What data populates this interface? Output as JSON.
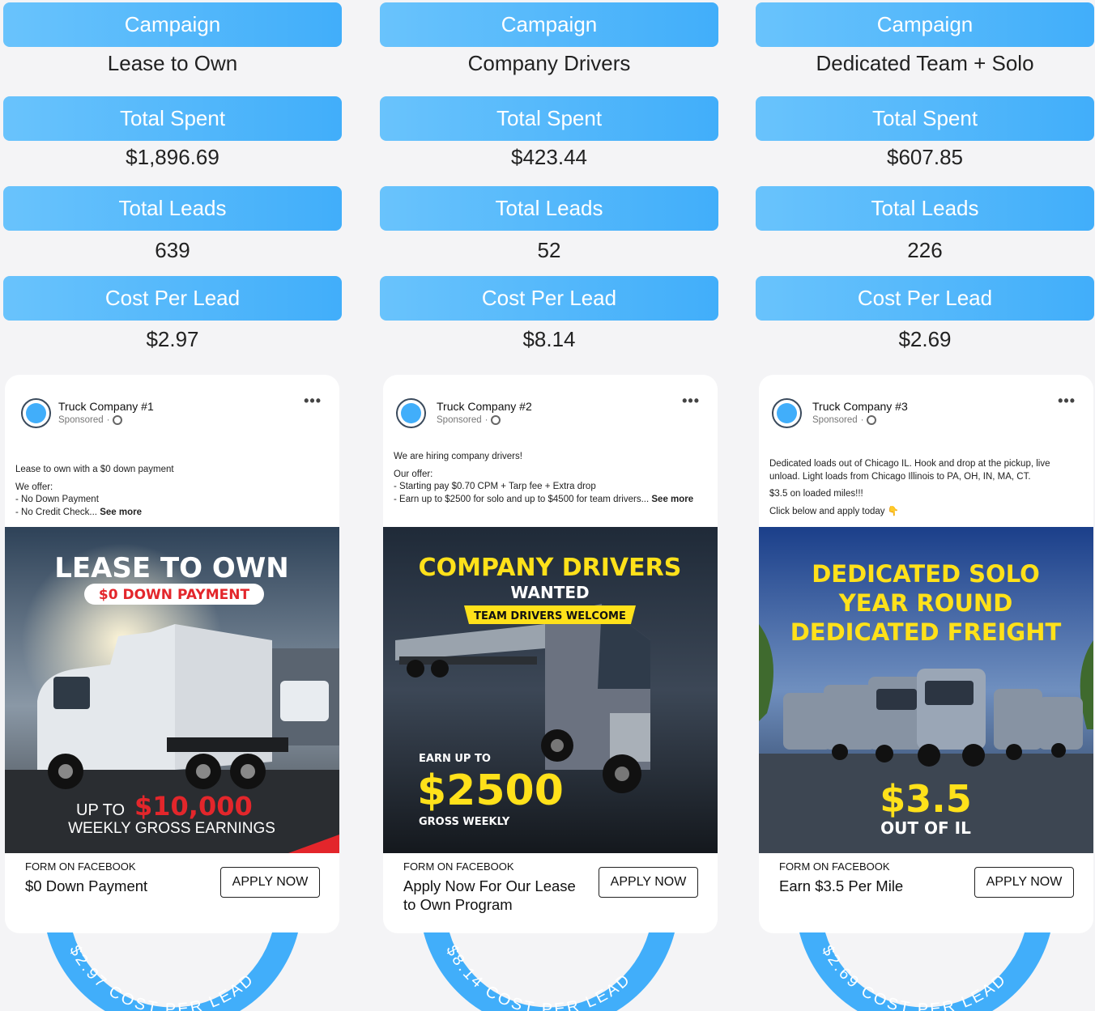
{
  "labels": {
    "campaign": "Campaign",
    "total_spent": "Total Spent",
    "total_leads": "Total Leads",
    "cost_per_lead": "Cost Per Lead"
  },
  "columns": [
    {
      "campaign": "Lease to Own",
      "total_spent": "$1,896.69",
      "total_leads": "639",
      "cost_per_lead": "$2.97",
      "page_name": "Truck Company #1",
      "sponsored": "Sponsored",
      "post_lines": [
        "Lease to own with a $0 down payment",
        "",
        "We offer:",
        "- No Down Payment",
        "- No Credit Check..."
      ],
      "see_more": "See more",
      "creative": {
        "line1": "LEASE TO OWN",
        "line2": "$0 DOWN PAYMENT",
        "line3a": "UP TO",
        "line3b": "$10,000",
        "line4": "WEEKLY GROSS EARNINGS"
      },
      "form_label": "FORM ON FACEBOOK",
      "headline": "$0 Down Payment",
      "cta": "APPLY NOW",
      "badge_text": "$2.97 COST PER LEAD"
    },
    {
      "campaign": "Company Drivers",
      "total_spent": "$423.44",
      "total_leads": "52",
      "cost_per_lead": "$8.14",
      "page_name": "Truck Company #2",
      "sponsored": "Sponsored",
      "post_lines": [
        "We are hiring company drivers!",
        "",
        "Our offer:",
        "- Starting pay $0.70 CPM + Tarp fee + Extra drop",
        "- Earn up to $2500 for solo and up to $4500 for team drivers..."
      ],
      "see_more": "See more",
      "creative": {
        "line1": "COMPANY DRIVERS",
        "line2": "WANTED",
        "line3": "TEAM DRIVERS WELCOME",
        "line4": "EARN UP TO",
        "line5": "$2500",
        "line6": "GROSS WEEKLY"
      },
      "form_label": "FORM ON FACEBOOK",
      "headline": "Apply Now For Our Lease to Own Program",
      "cta": "APPLY NOW",
      "badge_text": "$8.14 COST PER LEAD"
    },
    {
      "campaign": "Dedicated Team + Solo",
      "total_spent": "$607.85",
      "total_leads": "226",
      "cost_per_lead": "$2.69",
      "page_name": "Truck Company #3",
      "sponsored": "Sponsored",
      "post_lines": [
        "Dedicated loads out of Chicago IL. Hook and drop at the pickup, live unload. Light loads from Chicago Illinois to PA, OH, IN, MA, CT.",
        "",
        "$3.5 on loaded miles!!!",
        "",
        "Click below and apply today 👇"
      ],
      "see_more": "",
      "creative": {
        "line1": "DEDICATED SOLO",
        "line2": "YEAR ROUND",
        "line3": "DEDICATED FREIGHT",
        "line4": "$3.5",
        "line5": "OUT OF IL"
      },
      "form_label": "FORM ON FACEBOOK",
      "headline": "Earn $3.5 Per Mile",
      "cta": "APPLY NOW",
      "badge_text": "$2.69 COST PER LEAD"
    }
  ],
  "colors": {
    "accent": "#41aefa",
    "accent_light": "#69c3fc",
    "yellow": "#ffe11a",
    "red": "#e3262b"
  }
}
